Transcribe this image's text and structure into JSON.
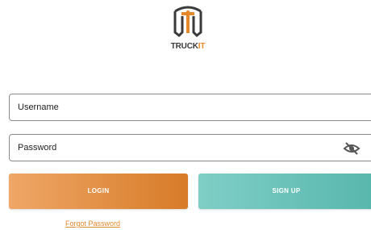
{
  "brand": {
    "logo_icon": "truckit-logo-icon",
    "name_part_1": "TRUCK",
    "name_part_2": "IT",
    "accent_color": "#e5892a",
    "dark_color": "#3a3a3a"
  },
  "form": {
    "username_label": "Username",
    "password_label": "Password",
    "password_toggle_icon": "eye-off-icon"
  },
  "buttons": {
    "login_label": "LOGIN",
    "signup_label": "SIGN UP",
    "login_color": "#e08a35",
    "signup_color": "#6cc3ba"
  },
  "links": {
    "forgot_password": "Forgot Password"
  }
}
